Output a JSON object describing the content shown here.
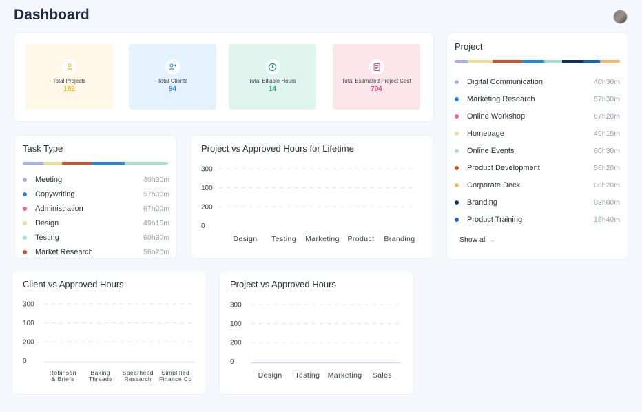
{
  "header": {
    "title": "Dashboard"
  },
  "stats": [
    {
      "label": "Total Projects",
      "value": "182",
      "icon": "user-icon",
      "color": "#f5b800"
    },
    {
      "label": "Total Clients",
      "value": "94",
      "icon": "clients-icon",
      "color": "#1e88e5"
    },
    {
      "label": "Total Billable Hours",
      "value": "14",
      "icon": "clock-icon",
      "color": "#1aa37a"
    },
    {
      "label": "Total Estimated Project Cost",
      "value": "704",
      "icon": "invoice-icon",
      "color": "#ec407a"
    }
  ],
  "task_type": {
    "title": "Task Type",
    "items": [
      {
        "name": "Meeting",
        "hours": "40h30m",
        "color": "#a9aef0"
      },
      {
        "name": "Copywriting",
        "hours": "57h30m",
        "color": "#1e88e5"
      },
      {
        "name": "Administration",
        "hours": "67h20m",
        "color": "#f06292"
      },
      {
        "name": "Design",
        "hours": "49h15m",
        "color": "#ecdf8c"
      },
      {
        "name": "Testing",
        "hours": "60h30m",
        "color": "#a5e0cf"
      },
      {
        "name": "Market Research",
        "hours": "56h20m",
        "color": "#d84f2a"
      }
    ],
    "bar_segments": [
      {
        "color": "#a9aef0",
        "share": 0.14
      },
      {
        "color": "#ecdf8c",
        "share": 0.13
      },
      {
        "color": "#d84f2a",
        "share": 0.21
      },
      {
        "color": "#1e88e5",
        "share": 0.22
      },
      {
        "color": "#a5e0cf",
        "share": 0.3
      }
    ]
  },
  "project": {
    "title": "Project",
    "items": [
      {
        "name": "Digital Communication",
        "hours": "40h30m",
        "color": "#a9aef0"
      },
      {
        "name": "Marketing Research",
        "hours": "57h30m",
        "color": "#1e88e5"
      },
      {
        "name": "Online Workshop",
        "hours": "67h20m",
        "color": "#f06292"
      },
      {
        "name": "Homepage",
        "hours": "49h15m",
        "color": "#ecdf8c"
      },
      {
        "name": "Online Events",
        "hours": "60h30m",
        "color": "#a5e0cf"
      },
      {
        "name": "Product Development",
        "hours": "56h20m",
        "color": "#d84f2a"
      },
      {
        "name": "Corporate Deck",
        "hours": "06h20m",
        "color": "#f6b860"
      },
      {
        "name": "Branding",
        "hours": "03h00m",
        "color": "#0f3460"
      },
      {
        "name": "Product Training",
        "hours": "16h40m",
        "color": "#1565c0"
      }
    ],
    "bar_segments": [
      {
        "color": "#a9aef0",
        "share": 0.08
      },
      {
        "color": "#ecdf8c",
        "share": 0.15
      },
      {
        "color": "#d84f2a",
        "share": 0.18
      },
      {
        "color": "#1e88e5",
        "share": 0.13
      },
      {
        "color": "#a5e0cf",
        "share": 0.11
      },
      {
        "color": "#0f3460",
        "share": 0.13
      },
      {
        "color": "#1565c0",
        "share": 0.1
      },
      {
        "color": "#f6b860",
        "share": 0.12
      }
    ],
    "show_all": "Show all"
  },
  "chart_data": [
    {
      "type": "bar",
      "title": "Project vs Approved Hours for Lifetime",
      "categories": [
        "Design",
        "Testing",
        "Marketing",
        "Product",
        "Branding"
      ],
      "y_tick_labels": [
        "300",
        "100",
        "200",
        "0"
      ],
      "series": [],
      "grid": true
    },
    {
      "type": "bar",
      "title": "Client vs Approved Hours",
      "categories": [
        [
          "Robinson",
          "& Briefs"
        ],
        [
          "Baking",
          "Threads"
        ],
        [
          "Spearhead",
          "Research"
        ],
        [
          "Simplified",
          "Finance Co"
        ]
      ],
      "y_tick_labels": [
        "300",
        "100",
        "200",
        "0"
      ],
      "series": [],
      "grid": true
    },
    {
      "type": "bar",
      "title": "Project vs Approved Hours",
      "categories": [
        "Design",
        "Testing",
        "Marketing",
        "Sales"
      ],
      "y_tick_labels": [
        "300",
        "100",
        "200",
        "0"
      ],
      "series": [],
      "grid": true
    }
  ]
}
